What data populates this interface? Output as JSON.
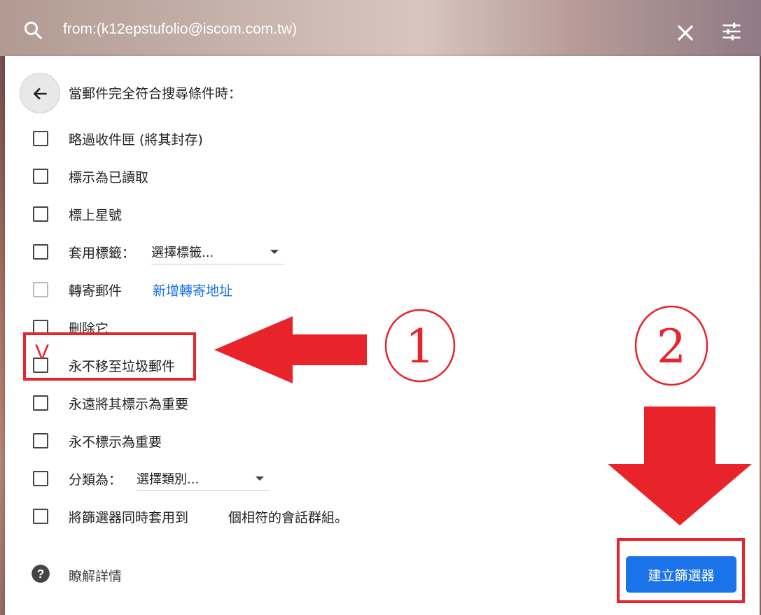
{
  "search": {
    "query": "from:(k12epstufolio@iscom.com.tw)"
  },
  "filter": {
    "header": "當郵件完全符合搜尋條件時：",
    "options": [
      {
        "label": "略過收件匣 (將其封存)"
      },
      {
        "label": "標示為已讀取"
      },
      {
        "label": "標上星號"
      },
      {
        "label": "套用標籤：",
        "select_value": "選擇標籤..."
      },
      {
        "label": "轉寄郵件",
        "link": "新增轉寄地址"
      },
      {
        "label": "刪除它"
      },
      {
        "label": "永不移至垃圾郵件"
      },
      {
        "label": "永遠將其標示為重要"
      },
      {
        "label": "永不標示為重要"
      },
      {
        "label": "分類為：",
        "select_value": "選擇類別..."
      },
      {
        "label": "將篩選器同時套用到",
        "suffix": "個相符的會話群組。"
      }
    ],
    "help_text": "瞭解詳情",
    "create_button": "建立篩選器"
  },
  "annotations": {
    "check_mark": "V",
    "step1": "1",
    "step2": "2",
    "accent_color": "#e8232a"
  },
  "colors": {
    "primary": "#1a73e8"
  }
}
